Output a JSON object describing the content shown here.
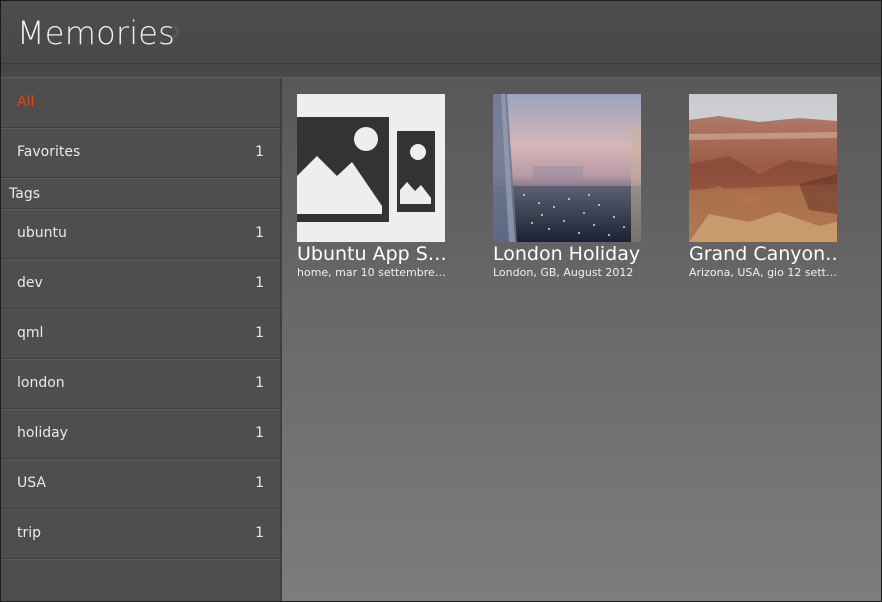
{
  "header": {
    "title": "Memories"
  },
  "sidebar": {
    "top_items": [
      {
        "label": "All",
        "count": "",
        "active": true
      },
      {
        "label": "Favorites",
        "count": "1",
        "active": false
      }
    ],
    "tags_header": "Tags",
    "tags": [
      {
        "label": "ubuntu",
        "count": "1"
      },
      {
        "label": "dev",
        "count": "1"
      },
      {
        "label": "qml",
        "count": "1"
      },
      {
        "label": "london",
        "count": "1"
      },
      {
        "label": "holiday",
        "count": "1"
      },
      {
        "label": "USA",
        "count": "1"
      },
      {
        "label": "trip",
        "count": "1"
      }
    ]
  },
  "memories": [
    {
      "title": "Ubuntu App S…",
      "subtitle": "home, mar 10 settembre…",
      "thumbnail_icon": "placeholder-image-icon"
    },
    {
      "title": "London Holiday",
      "subtitle": "London, GB, August 2012",
      "thumbnail_icon": "london-skyline-photo"
    },
    {
      "title": "Grand Canyon…",
      "subtitle": "Arizona, USA, gio 12 sett…",
      "thumbnail_icon": "grand-canyon-photo"
    }
  ],
  "colors": {
    "accent": "#dd4814",
    "text": "#eaeaea",
    "sidebar_bg": "#4e4e4e"
  }
}
